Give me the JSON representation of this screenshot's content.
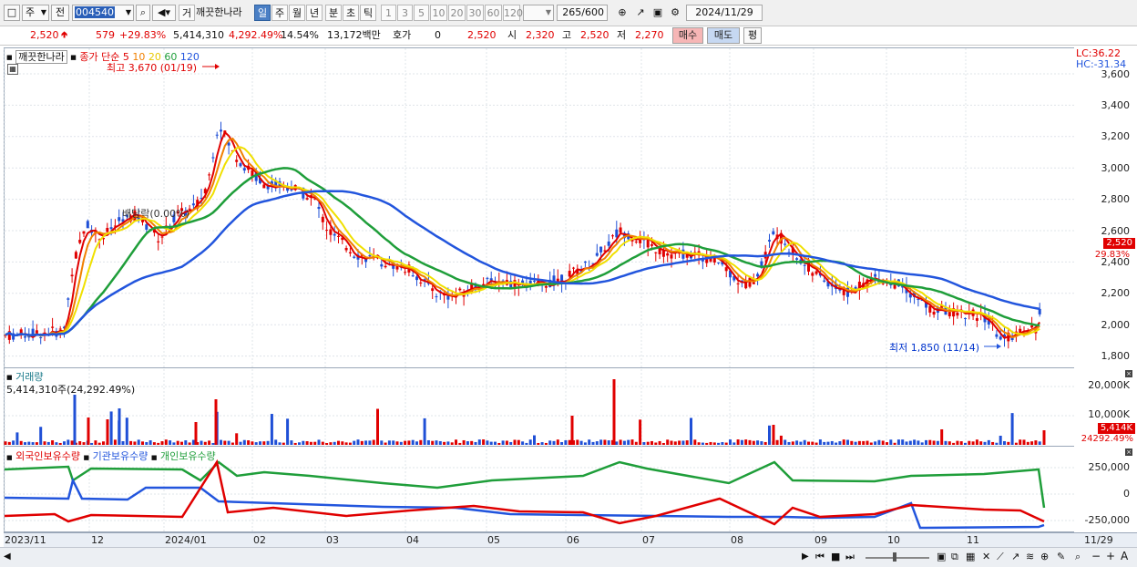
{
  "toolbar": {
    "market": "주",
    "prev": "전",
    "code": "004540",
    "trade_btn": "거",
    "stock_name": "깨끗한나라",
    "periods": [
      "일",
      "주",
      "월",
      "년",
      "분",
      "초",
      "틱"
    ],
    "active_period": "일",
    "minutes": [
      "1",
      "3",
      "5",
      "10",
      "20",
      "30",
      "60",
      "120"
    ],
    "count": "265",
    "count_total": "/600",
    "date": "2024/11/29"
  },
  "quote": {
    "price": "2,520",
    "change": "579",
    "change_pct": "+29.83%",
    "volume": "5,414,310",
    "volume_pct": "4,292.49%",
    "turnover": "14.54%",
    "amount": "13,172백만",
    "hoga_label": "호가",
    "hoga_value": "0",
    "last": "2,520",
    "open_label": "시",
    "open": "2,320",
    "high_label": "고",
    "high": "2,520",
    "low_label": "저",
    "low": "2,270",
    "buy_label": "매수",
    "sell_label": "매도",
    "eval_label": "평"
  },
  "price_panel": {
    "stock_label": "깨끗한나라",
    "ma_label": "종가 단순",
    "ma_periods": [
      "5",
      "10",
      "20",
      "60",
      "120"
    ],
    "ma_colors": [
      "#e00000",
      "#f08000",
      "#f0e000",
      "#1f9e3a",
      "#2255dd"
    ],
    "lc": "LC:36.22",
    "hc": "HC:-31.34",
    "high_marker": "최고 3,670 (01/19)",
    "low_marker": "최저 1,850 (11/14)",
    "dividend_note": "배당락(0.00%)",
    "y_ticks": [
      "3,600",
      "3,400",
      "3,200",
      "3,000",
      "2,800",
      "2,600",
      "2,400",
      "2,200",
      "2,000",
      "1,800"
    ],
    "price_badge": "2,520",
    "pct_badge": "29.83%"
  },
  "volume_panel": {
    "title": "거래량",
    "summary": "5,414,310주(24,292.49%)",
    "y_ticks": [
      "20,000K",
      "10,000K"
    ],
    "vol_badge": "5,414K",
    "pct_badge": "24292.49%"
  },
  "holding_panel": {
    "series": [
      "외국인보유수량",
      "기관보유수량",
      "개인보유수량"
    ],
    "colors": [
      "#e00000",
      "#2255dd",
      "#1f9e3a"
    ],
    "y_ticks": [
      "250,000",
      "0",
      "-250,000"
    ]
  },
  "date_axis": {
    "labels": [
      "2023/11",
      "12",
      "2024/01",
      "02",
      "03",
      "04",
      "05",
      "06",
      "07",
      "08",
      "09",
      "10",
      "11"
    ],
    "right_label": "11/29"
  }
}
